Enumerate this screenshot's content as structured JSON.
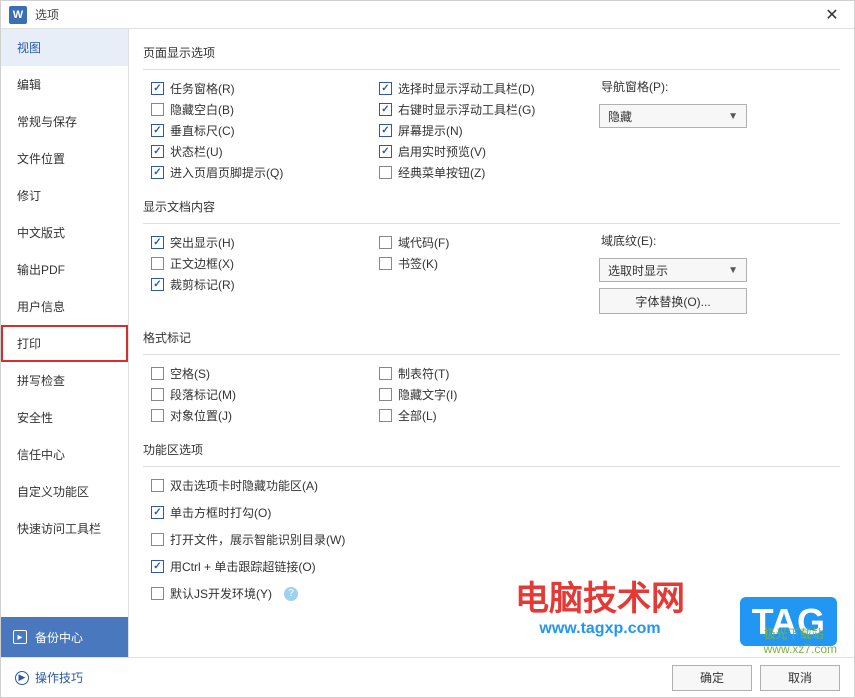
{
  "titlebar": {
    "title": "选项"
  },
  "sidebar": {
    "items": [
      {
        "label": "视图"
      },
      {
        "label": "编辑"
      },
      {
        "label": "常规与保存"
      },
      {
        "label": "文件位置"
      },
      {
        "label": "修订"
      },
      {
        "label": "中文版式"
      },
      {
        "label": "输出PDF"
      },
      {
        "label": "用户信息"
      },
      {
        "label": "打印"
      },
      {
        "label": "拼写检查"
      },
      {
        "label": "安全性"
      },
      {
        "label": "信任中心"
      },
      {
        "label": "自定义功能区"
      },
      {
        "label": "快速访问工具栏"
      }
    ],
    "active_index": 0,
    "highlighted_index": 8,
    "backup_center": "备份中心"
  },
  "groups": {
    "page_display": {
      "title": "页面显示选项",
      "col1": [
        {
          "label": "任务窗格(R)",
          "checked": true
        },
        {
          "label": "隐藏空白(B)",
          "checked": false
        },
        {
          "label": "垂直标尺(C)",
          "checked": true
        },
        {
          "label": "状态栏(U)",
          "checked": true
        },
        {
          "label": "进入页眉页脚提示(Q)",
          "checked": true
        }
      ],
      "col2": [
        {
          "label": "选择时显示浮动工具栏(D)",
          "checked": true
        },
        {
          "label": "右键时显示浮动工具栏(G)",
          "checked": true
        },
        {
          "label": "屏幕提示(N)",
          "checked": true
        },
        {
          "label": "启用实时预览(V)",
          "checked": true
        },
        {
          "label": "经典菜单按钮(Z)",
          "checked": false
        }
      ],
      "nav_pane": {
        "label": "导航窗格(P):",
        "value": "隐藏"
      }
    },
    "doc_content": {
      "title": "显示文档内容",
      "col1": [
        {
          "label": "突出显示(H)",
          "checked": true
        },
        {
          "label": "正文边框(X)",
          "checked": false
        },
        {
          "label": "裁剪标记(R)",
          "checked": true
        }
      ],
      "col2": [
        {
          "label": "域代码(F)",
          "checked": false
        },
        {
          "label": "书签(K)",
          "checked": false
        }
      ],
      "field_shading": {
        "label": "域底纹(E):",
        "value": "选取时显示"
      },
      "font_replace_btn": "字体替换(O)..."
    },
    "format_marks": {
      "title": "格式标记",
      "col1": [
        {
          "label": "空格(S)",
          "checked": false
        },
        {
          "label": "段落标记(M)",
          "checked": false
        },
        {
          "label": "对象位置(J)",
          "checked": false
        }
      ],
      "col2": [
        {
          "label": "制表符(T)",
          "checked": false
        },
        {
          "label": "隐藏文字(I)",
          "checked": false
        },
        {
          "label": "全部(L)",
          "checked": false
        }
      ]
    },
    "ribbon": {
      "title": "功能区选项",
      "items": [
        {
          "label": "双击选项卡时隐藏功能区(A)",
          "checked": false
        },
        {
          "label": "单击方框时打勾(O)",
          "checked": true
        },
        {
          "label": "打开文件，展示智能识别目录(W)",
          "checked": false
        },
        {
          "label": "用Ctrl + 单击跟踪超链接(O)",
          "checked": true
        },
        {
          "label": "默认JS开发环境(Y)",
          "checked": false,
          "has_help": true
        }
      ]
    }
  },
  "footer": {
    "tips": "操作技巧",
    "ok": "确定",
    "cancel": "取消"
  },
  "watermarks": {
    "w1big": "电脑技术网",
    "w1small": "www.tagxp.com",
    "w2": "TAG",
    "w3": "极光下载站",
    "w3b": "www.xz7.com"
  }
}
